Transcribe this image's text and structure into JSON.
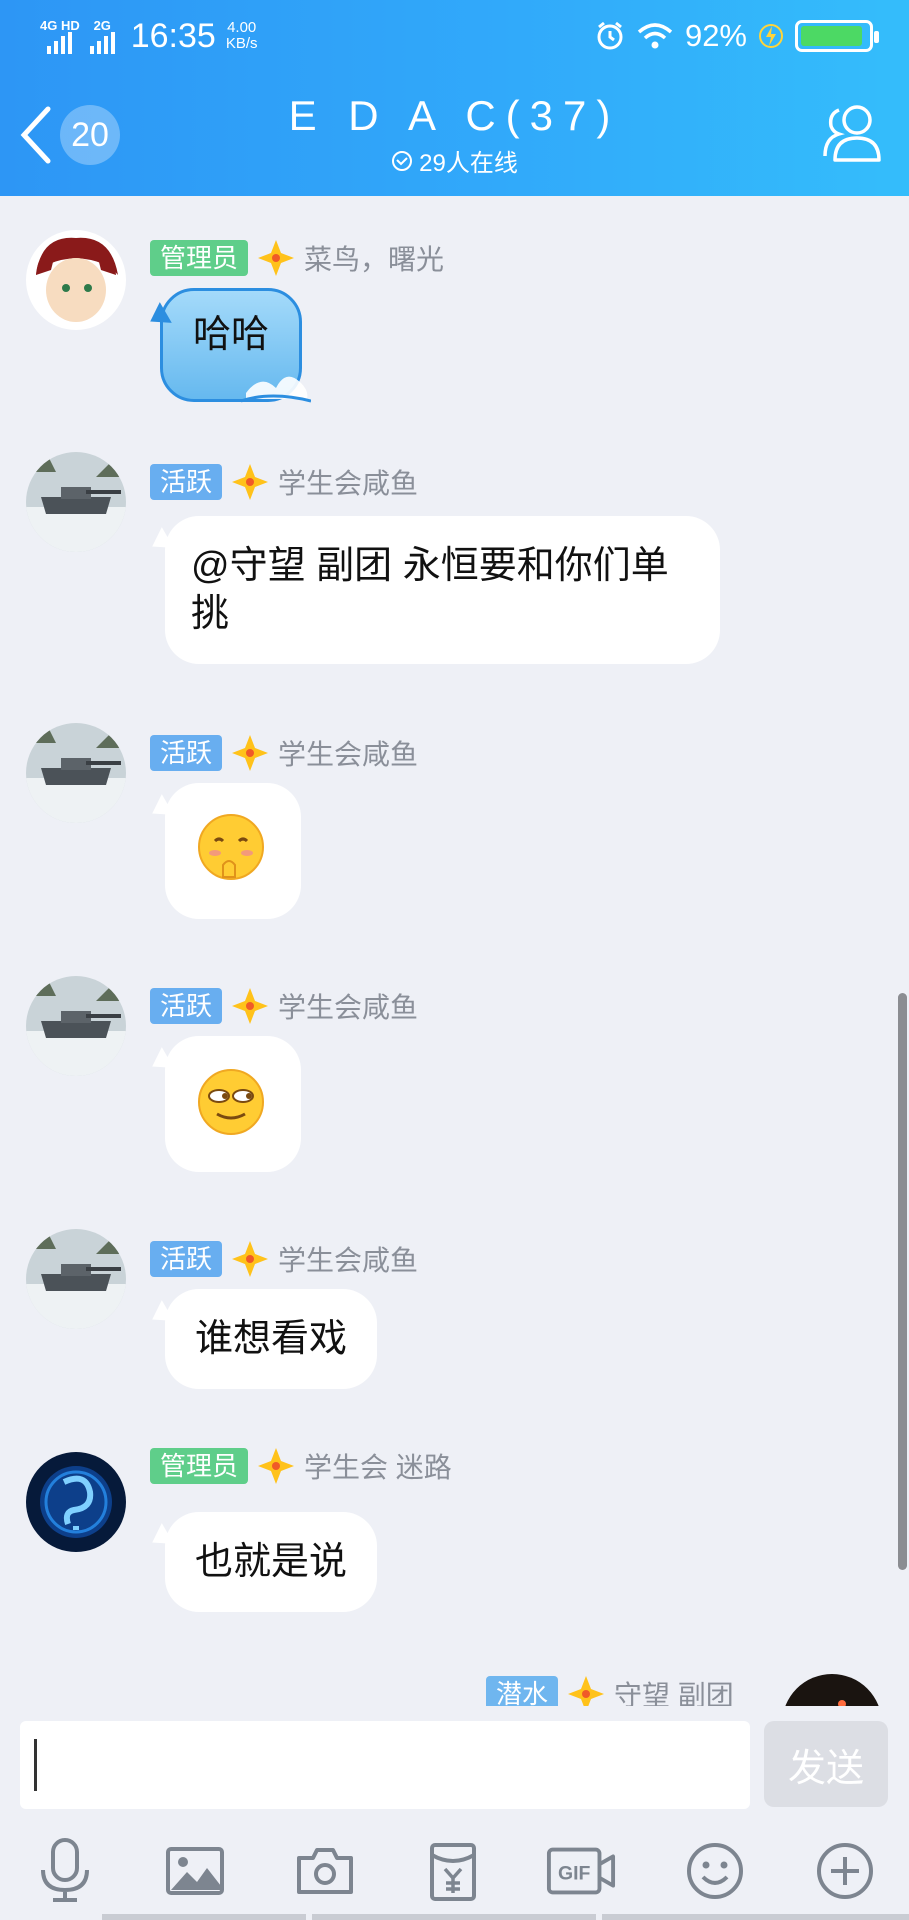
{
  "status_bar": {
    "network1": "4G HD",
    "network2": "2G",
    "time": "16:35",
    "speed_value": "4.00",
    "speed_unit": "KB/s",
    "battery": "92%",
    "battery_level": 0.92
  },
  "header": {
    "unread_count": "20",
    "title": "E D A  C(37)",
    "online": "29人在线"
  },
  "messages": [
    {
      "badge": "管理员",
      "badge_type": "admin",
      "sender": "菜鸟，曙光",
      "text": "哈哈",
      "style": "blue"
    },
    {
      "badge": "活跃",
      "badge_type": "active",
      "sender": "学生会咸鱼",
      "text": "@守望  副团 永恒要和你们单挑",
      "style": "white"
    },
    {
      "badge": "活跃",
      "badge_type": "active",
      "sender": "学生会咸鱼",
      "emoji": "thinking-emoji"
    },
    {
      "badge": "活跃",
      "badge_type": "active",
      "sender": "学生会咸鱼",
      "emoji": "smirk-emoji"
    },
    {
      "badge": "活跃",
      "badge_type": "active",
      "sender": "学生会咸鱼",
      "text": "谁想看戏",
      "style": "white"
    },
    {
      "badge": "管理员",
      "badge_type": "admin",
      "sender": "学生会 迷路",
      "text": "也就是说",
      "style": "white"
    },
    {
      "badge": "潜水",
      "badge_type": "lurk",
      "sender": "守望  副团"
    }
  ],
  "input": {
    "placeholder": "",
    "value": "",
    "send_label": "发送"
  },
  "toolbar": [
    "mic-icon",
    "image-icon",
    "camera-icon",
    "red-packet-icon",
    "gif-icon",
    "emoji-icon",
    "plus-icon"
  ],
  "colors": {
    "header_start": "#2d96f5",
    "header_end": "#34bdfb",
    "admin_badge": "#5fce8a",
    "active_badge": "#68aef0",
    "background": "#eef0f6"
  }
}
